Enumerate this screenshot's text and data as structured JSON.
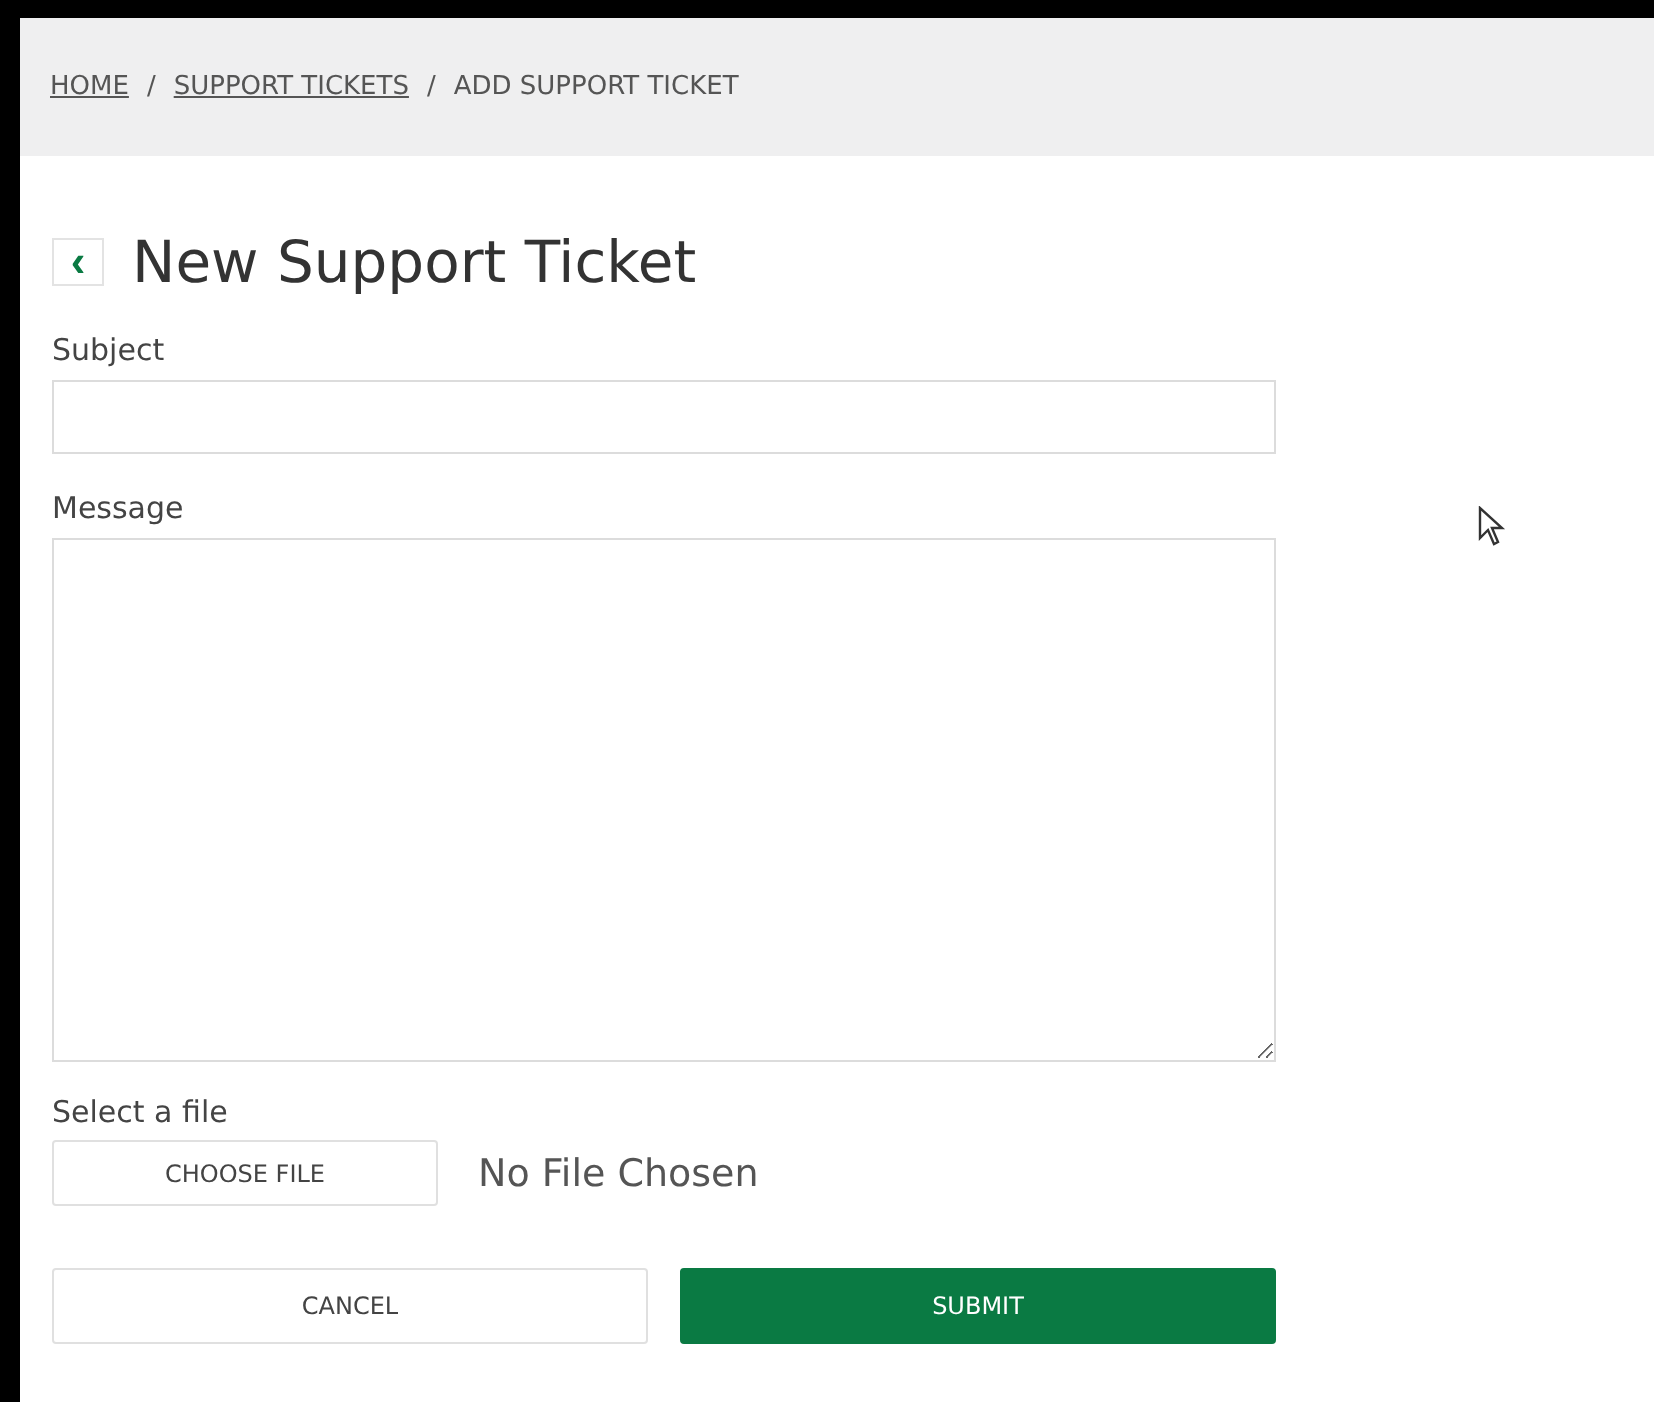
{
  "breadcrumb": [
    {
      "label": "HOME",
      "link": true
    },
    {
      "label": "SUPPORT TICKETS",
      "link": true
    },
    {
      "label": "ADD SUPPORT TICKET",
      "link": false
    }
  ],
  "breadcrumb_separator": "/",
  "back_button": "‹",
  "title": "New Support Ticket",
  "fields": [
    {
      "label": "Subject",
      "kind": "input"
    },
    {
      "label": "Message",
      "kind": "textarea"
    }
  ],
  "file": {
    "label": "Select a file",
    "button": "CHOOSE FILE",
    "status": "No File Chosen"
  },
  "buttons": [
    {
      "label": "CANCEL",
      "kind": "secondary"
    },
    {
      "label": "SUBMIT",
      "kind": "primary"
    }
  ]
}
